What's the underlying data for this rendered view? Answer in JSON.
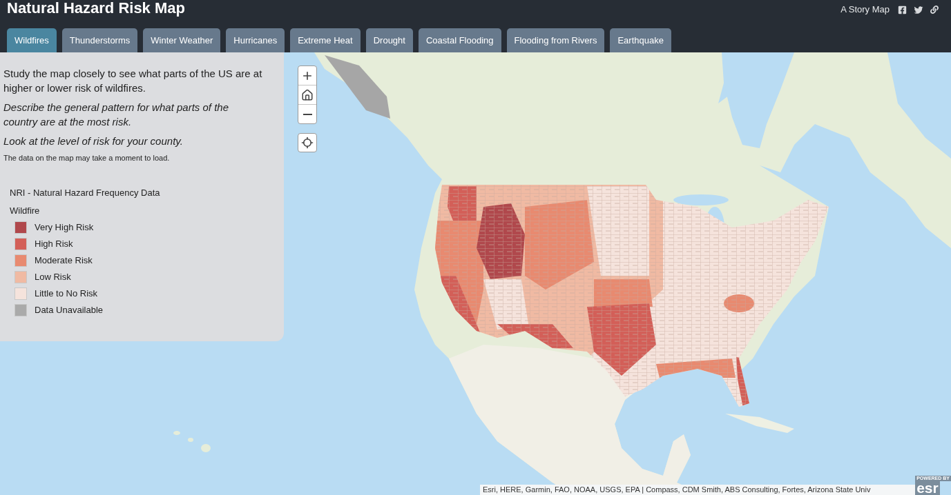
{
  "header": {
    "title": "Natural Hazard Risk Map",
    "story_map_label": "A Story Map"
  },
  "tabs": [
    {
      "label": "Wildfires",
      "selected": true
    },
    {
      "label": "Thunderstorms",
      "selected": false
    },
    {
      "label": "Winter Weather",
      "selected": false
    },
    {
      "label": "Hurricanes",
      "selected": false
    },
    {
      "label": "Extreme Heat",
      "selected": false
    },
    {
      "label": "Drought",
      "selected": false
    },
    {
      "label": "Coastal Flooding",
      "selected": false
    },
    {
      "label": "Flooding from Rivers",
      "selected": false
    },
    {
      "label": "Earthquake",
      "selected": false
    }
  ],
  "panel": {
    "paragraphs": [
      {
        "kind": "body",
        "text": "Study the map closely to see what parts of the US are at higher or lower risk of wildfires."
      },
      {
        "kind": "italic",
        "text": "Describe the general pattern for what parts of the country are at the most risk."
      },
      {
        "kind": "italic",
        "text": "Look at the level of risk for your county."
      },
      {
        "kind": "note",
        "text": "The data on the map may take a moment to load."
      }
    ],
    "legend": {
      "title": "NRI - Natural Hazard Frequency Data",
      "layer": "Wildfire",
      "items": [
        {
          "label": "Very High Risk",
          "color": "#b0484c"
        },
        {
          "label": "High Risk",
          "color": "#d35f58"
        },
        {
          "label": "Moderate Risk",
          "color": "#e88a70"
        },
        {
          "label": "Low Risk",
          "color": "#f0baa3"
        },
        {
          "label": "Little to No Risk",
          "color": "#f5e3dc"
        },
        {
          "label": "Data Unavailable",
          "color": "#aaaaaa"
        }
      ]
    }
  },
  "map": {
    "attribution": "Esri, HERE, Garmin, FAO, NOAA, USGS, EPA | Compass, CDM Smith, ABS Consulting, Fortes, Arizona State Univ",
    "logo": {
      "caption": "POWERED BY",
      "name": "esr"
    }
  }
}
